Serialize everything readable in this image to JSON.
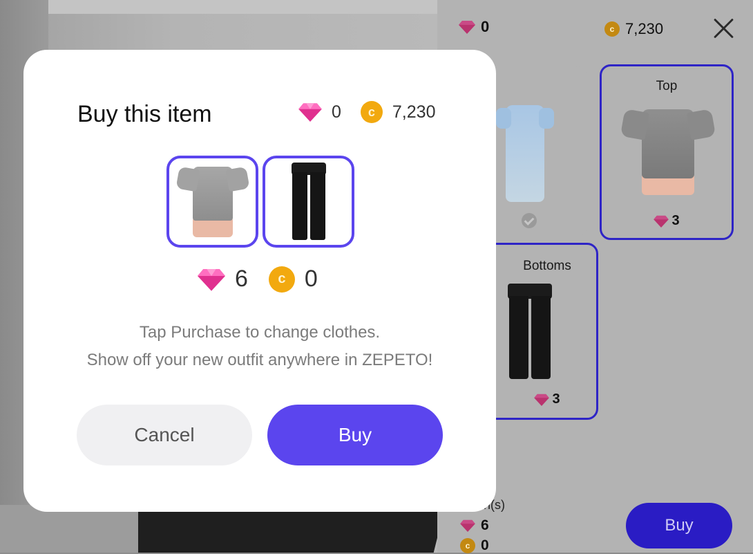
{
  "colors": {
    "accent": "#5b45ee",
    "gem": "#ee3d9f",
    "coin": "#f2a90f"
  },
  "side_panel": {
    "gems": "0",
    "coins": "7,230",
    "close_icon": "close-icon",
    "cards": [
      {
        "category": "",
        "item": "dress",
        "selected": false,
        "owned": true
      },
      {
        "category": "Top",
        "price": "3",
        "selected": true
      },
      {
        "category": "Bottoms",
        "price": "3",
        "selected": true
      }
    ],
    "items_label": "n(s)",
    "total_gems": "6",
    "total_coins": "0",
    "buy_label": "Buy"
  },
  "modal": {
    "title": "Buy this item",
    "gems": "0",
    "coins": "7,230",
    "items": [
      "Top",
      "Bottoms"
    ],
    "price_gems": "6",
    "price_coins": "0",
    "message_line1": "Tap Purchase to change clothes.",
    "message_line2": "Show off your new outfit anywhere in ZEPETO!",
    "cancel_label": "Cancel",
    "buy_label": "Buy"
  }
}
